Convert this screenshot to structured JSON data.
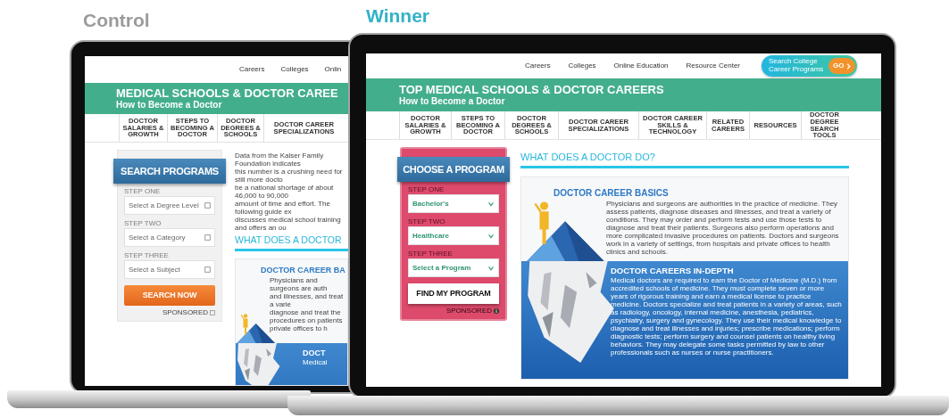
{
  "laptops": [
    {
      "kind": "control",
      "label": "Control",
      "nav": [
        "Careers",
        "Colleges",
        "Onlin"
      ],
      "banner": {
        "title": "MEDICAL SCHOOLS & DOCTOR CAREE",
        "subtitle": "How to Become a Doctor"
      },
      "subnav": [
        "DOCTOR SALARIES & GROWTH",
        "STEPS TO BECOMING A DOCTOR",
        "DOCTOR DEGREES & SCHOOLS",
        "DOCTOR CAREER SPECIALIZATIONS"
      ],
      "form": {
        "title": "SEARCH PROGRAMS",
        "steps": [
          {
            "label": "STEP ONE",
            "placeholder": "Select a Degree Level"
          },
          {
            "label": "STEP TWO",
            "placeholder": "Select a Category"
          },
          {
            "label": "STEP THREE",
            "placeholder": "Select a Subject"
          }
        ],
        "button": "SEARCH NOW",
        "sponsored": "SPONSORED"
      },
      "intro_lines": [
        "Data from the Kaiser Family Foundation indicates",
        "this number is a crushing need for still more docto",
        "be a national shortage of about 46,000 to 90,000",
        "amount of time and effort. The following guide ex",
        "discusses medical school training and offers an ou"
      ],
      "heading": "WHAT DOES A DOCTOR",
      "basics": {
        "title": "DOCTOR CAREER BA",
        "lines": [
          "Physicians and surgeons are auth",
          "and illnesses, and treat a varie",
          "diagnose and treat the",
          "procedures on patients",
          "private offices to h"
        ]
      },
      "in_depth": {
        "title": "DOCT",
        "lines": [
          "Medical"
        ]
      }
    },
    {
      "kind": "winner",
      "label": "Winner",
      "nav": [
        "Careers",
        "Colleges",
        "Online Education",
        "Resource Center"
      ],
      "cta": {
        "text": "Search College Career Programs",
        "button": "GO"
      },
      "banner": {
        "title": "TOP MEDICAL SCHOOLS & DOCTOR CAREERS",
        "subtitle": "How to Become a Doctor"
      },
      "subnav": [
        "DOCTOR SALARIES & GROWTH",
        "STEPS TO BECOMING A DOCTOR",
        "DOCTOR DEGREES & SCHOOLS",
        "DOCTOR CAREER SPECIALIZATIONS",
        "DOCTOR CAREER SKILLS & TECHNOLOGY",
        "RELATED CAREERS",
        "RESOURCES",
        "DOCTOR DEGREE SEARCH TOOLS"
      ],
      "form": {
        "title": "CHOOSE A PROGRAM",
        "steps": [
          {
            "label": "STEP ONE",
            "value": "Bachelor's"
          },
          {
            "label": "STEP TWO",
            "value": "Healthcare"
          },
          {
            "label": "STEP THREE",
            "value": "Select a Program"
          }
        ],
        "button": "FIND MY PROGRAM",
        "sponsored": "SPONSORED"
      },
      "heading": "WHAT DOES A DOCTOR DO?",
      "basics": {
        "title": "DOCTOR CAREER BASICS",
        "text": "Physicians and surgeons are authorities in the practice of medicine. They assess patients, diagnose diseases and illnesses, and treat a variety of conditions. They may order and perform tests and use those tests to diagnose and treat their patients. Surgeons also perform operations and more complicated invasive procedures on patients. Doctors and surgeons work in a variety of settings, from hospitals and private offices to health clinics and schools."
      },
      "in_depth": {
        "title": "DOCTOR CAREERS IN-DEPTH",
        "text": "Medical doctors are required to earn the Doctor of Medicine (M.D.) from accredited schools of medicine. They must complete seven or more years of rigorous training and earn a medical license to practice medicine. Doctors specialize and treat patients in a variety of areas, such as radiology, oncology, internal medicine, anesthesia, pediatrics, psychiatry, surgery and gynecology. They use their medical knowledge to diagnose and treat illnesses and injuries; prescribe medications; perform diagnostic tests; perform surgery and counsel patients on healthy living behaviors. They may delegate some tasks permitted by law to other professionals such as nurses or nurse practitioners."
      }
    }
  ]
}
